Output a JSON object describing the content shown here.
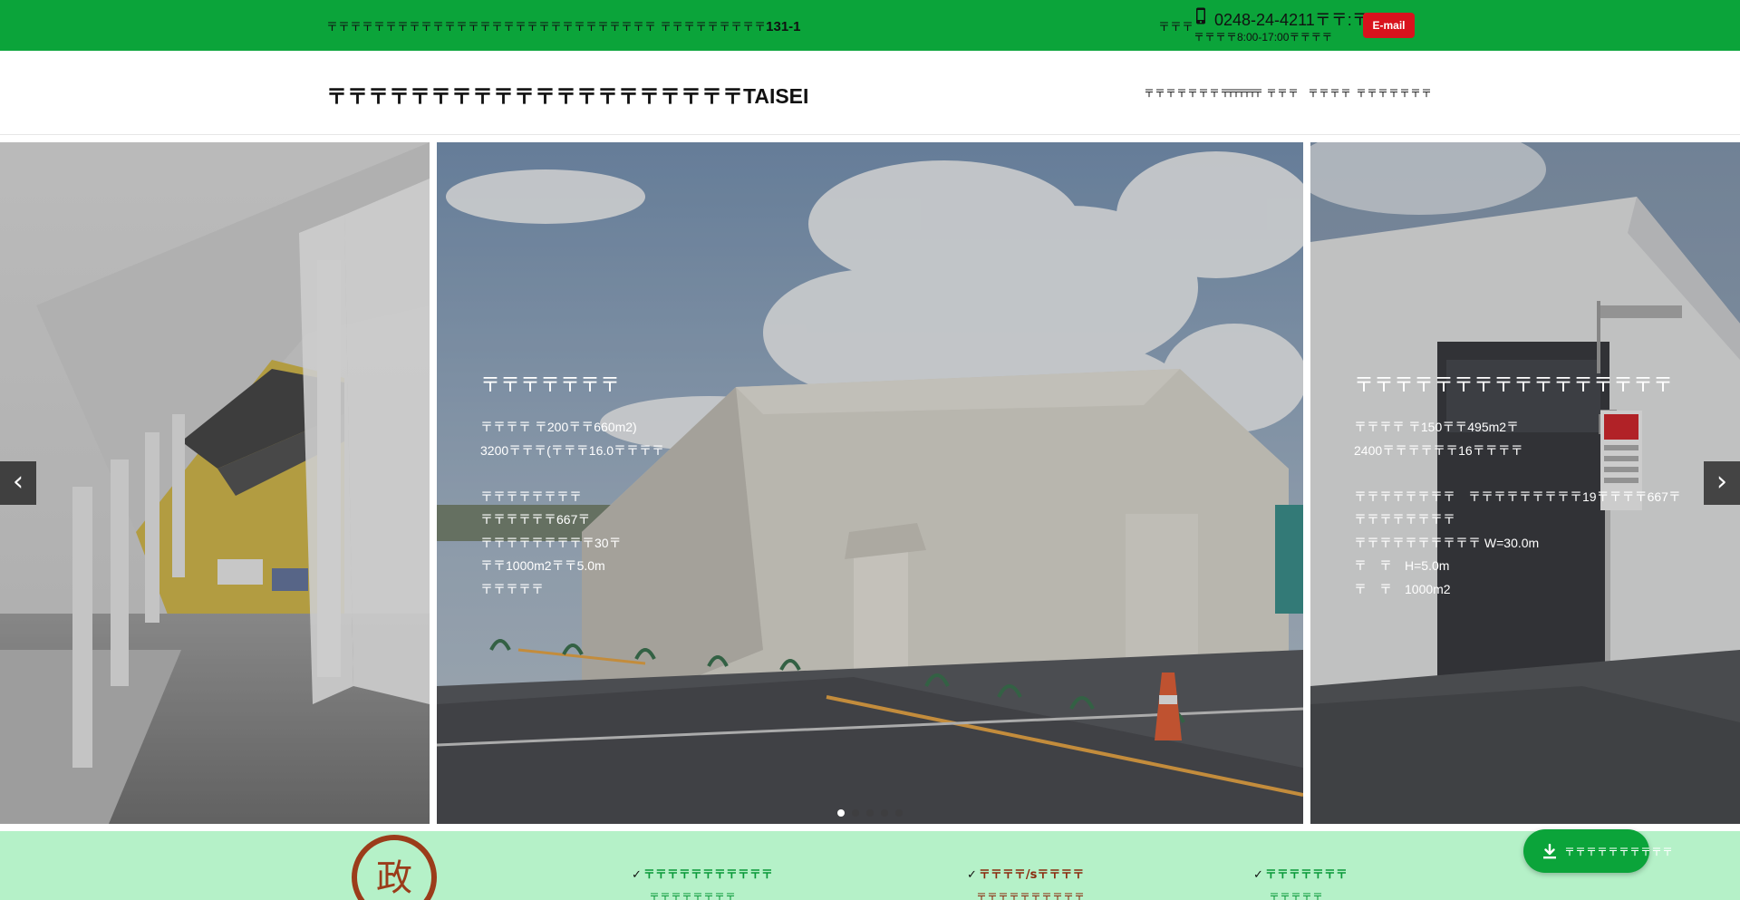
{
  "topbar": {
    "address": "〒〒〒〒〒〒〒〒〒〒〒〒〒〒〒〒〒〒〒〒〒〒〒〒〒〒〒〒 〒〒〒〒〒〒〒〒〒",
    "address_number": "131-1",
    "tel_label": "〒〒〒",
    "phone": "0248-24-4211〒〒:〒〒",
    "hours": "〒〒〒〒8:00-17:00〒〒〒〒",
    "email_label": "E-mail",
    "bar_color": "#0ba43a",
    "email_color": "#d9121d"
  },
  "header": {
    "logo": "〒〒〒〒〒〒〒〒〒〒〒〒〒〒〒〒〒〒〒〒TAISEI",
    "nav": [
      "〒〒〒〒〒〒〒〒〒〒〒",
      "〒〒〒",
      "〒〒〒",
      "〒〒〒〒",
      "〒〒〒〒〒〒〒"
    ]
  },
  "hero": {
    "prev_label": "‹",
    "next_label": "›",
    "active_dot": 0,
    "dot_count": 5,
    "slides": [
      {
        "title": "〒〒〒〒〒〒〒",
        "lines": [
          "〒〒〒〒 〒200〒〒660m2)",
          "3200〒〒〒(〒〒〒16.0〒〒〒〒",
          "",
          "〒〒〒〒〒〒〒〒",
          "〒〒〒〒〒〒667〒",
          "〒〒〒〒〒〒〒〒〒30〒",
          "〒〒1000m2〒〒5.0m",
          "〒〒〒〒〒"
        ]
      },
      {
        "title": "〒〒〒〒〒〒〒〒〒〒〒〒〒〒〒〒",
        "lines": [
          "〒〒〒〒 〒150〒〒495m2〒",
          "2400〒〒〒〒〒〒16〒〒〒〒",
          "",
          "〒〒〒〒〒〒〒〒　〒〒〒〒〒〒〒〒〒19〒〒〒〒667〒",
          "〒〒〒〒〒〒〒〒",
          "〒〒〒〒〒〒〒〒〒〒 W=30.0m",
          "〒　〒　H=5.0m",
          "〒　〒　1000m2"
        ]
      }
    ]
  },
  "features": {
    "items": [
      {
        "label": "〒〒〒〒〒〒〒〒〒〒〒",
        "sub": "〒〒〒〒〒〒〒〒",
        "color": "#0b9a3a"
      },
      {
        "label": "〒〒〒〒/s〒〒〒〒",
        "sub": "〒〒〒〒〒〒〒〒〒〒",
        "color": "#8b2a0e"
      },
      {
        "label": "〒〒〒〒〒〒〒",
        "sub": "〒〒〒〒〒",
        "color": "#0b9a3a"
      }
    ],
    "seal_char": "政",
    "download_label": "〒〒〒〒〒〒〒〒〒〒",
    "band_color": "#b5f1c8"
  }
}
